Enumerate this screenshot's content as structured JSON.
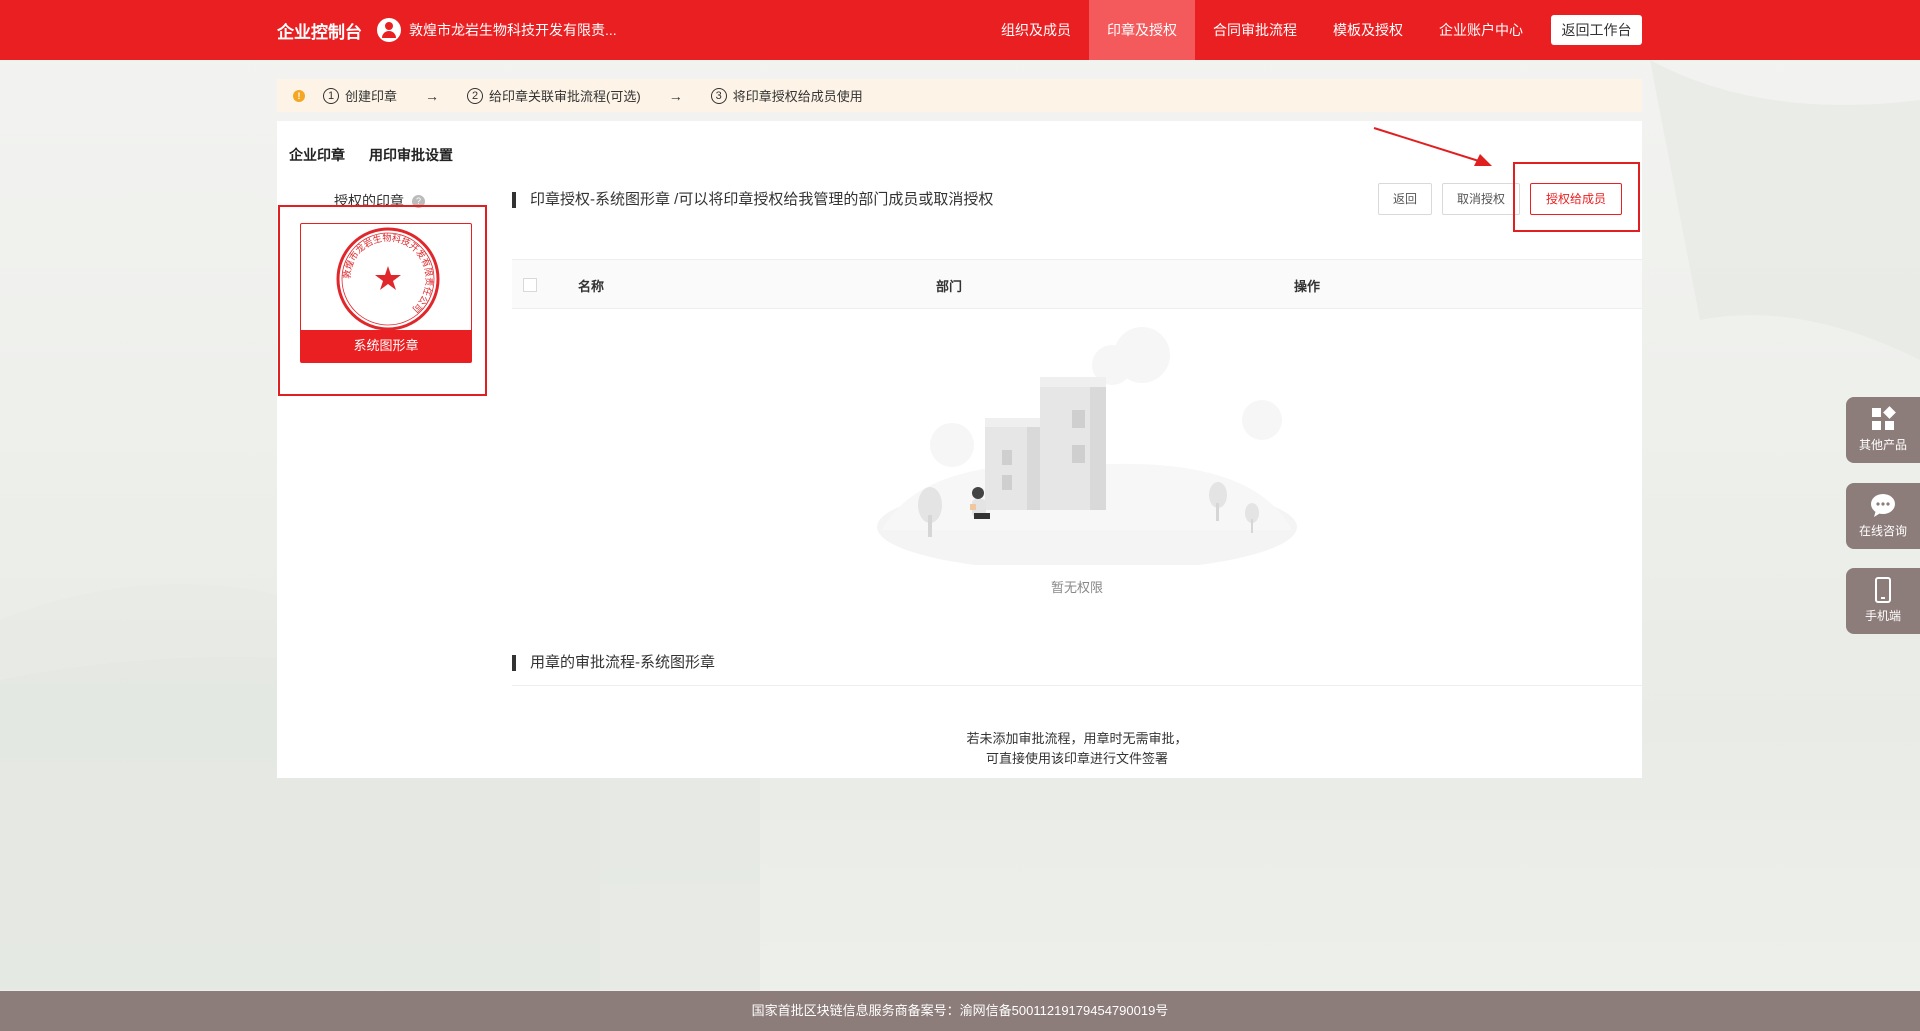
{
  "header": {
    "brand": "企业控制台",
    "company": "敦煌市龙岩生物科技开发有限责...",
    "nav": [
      "组织及成员",
      "印章及授权",
      "合同审批流程",
      "模板及授权",
      "企业账户中心"
    ],
    "active_nav": 1,
    "back_label": "返回工作台"
  },
  "steps": {
    "items": [
      {
        "num": "1",
        "label": "创建印章"
      },
      {
        "num": "2",
        "label": "给印章关联审批流程(可选)"
      },
      {
        "num": "3",
        "label": "将印章授权给成员使用"
      }
    ],
    "arrow": "→"
  },
  "tabs": [
    "企业印章",
    "用印审批设置"
  ],
  "left": {
    "title": "授权的印章",
    "seal_label": "系统图形章",
    "seal_ring_text": "敦煌市龙岩生物科技开发有限责任公司"
  },
  "auth": {
    "title": "印章授权-系统图形章   /可以将印章授权给我管理的部门成员或取消授权",
    "buttons": {
      "back": "返回",
      "cancel": "取消授权",
      "grant": "授权给成员"
    },
    "columns": [
      "名称",
      "部门",
      "操作"
    ],
    "empty": "暂无权限"
  },
  "approval": {
    "title": "用章的审批流程-系统图形章",
    "note_line1": "若未添加审批流程，用章时无需审批，",
    "note_line2": "可直接使用该印章进行文件签署"
  },
  "float": [
    "其他产品",
    "在线咨询",
    "手机端"
  ],
  "footer": "国家首批区块链信息服务商备案号：渝网信备50011219179454790019号",
  "colors": {
    "brand_red": "#ea1f22",
    "footer": "#8c7c7a",
    "step_bg": "#fdf4e7"
  }
}
